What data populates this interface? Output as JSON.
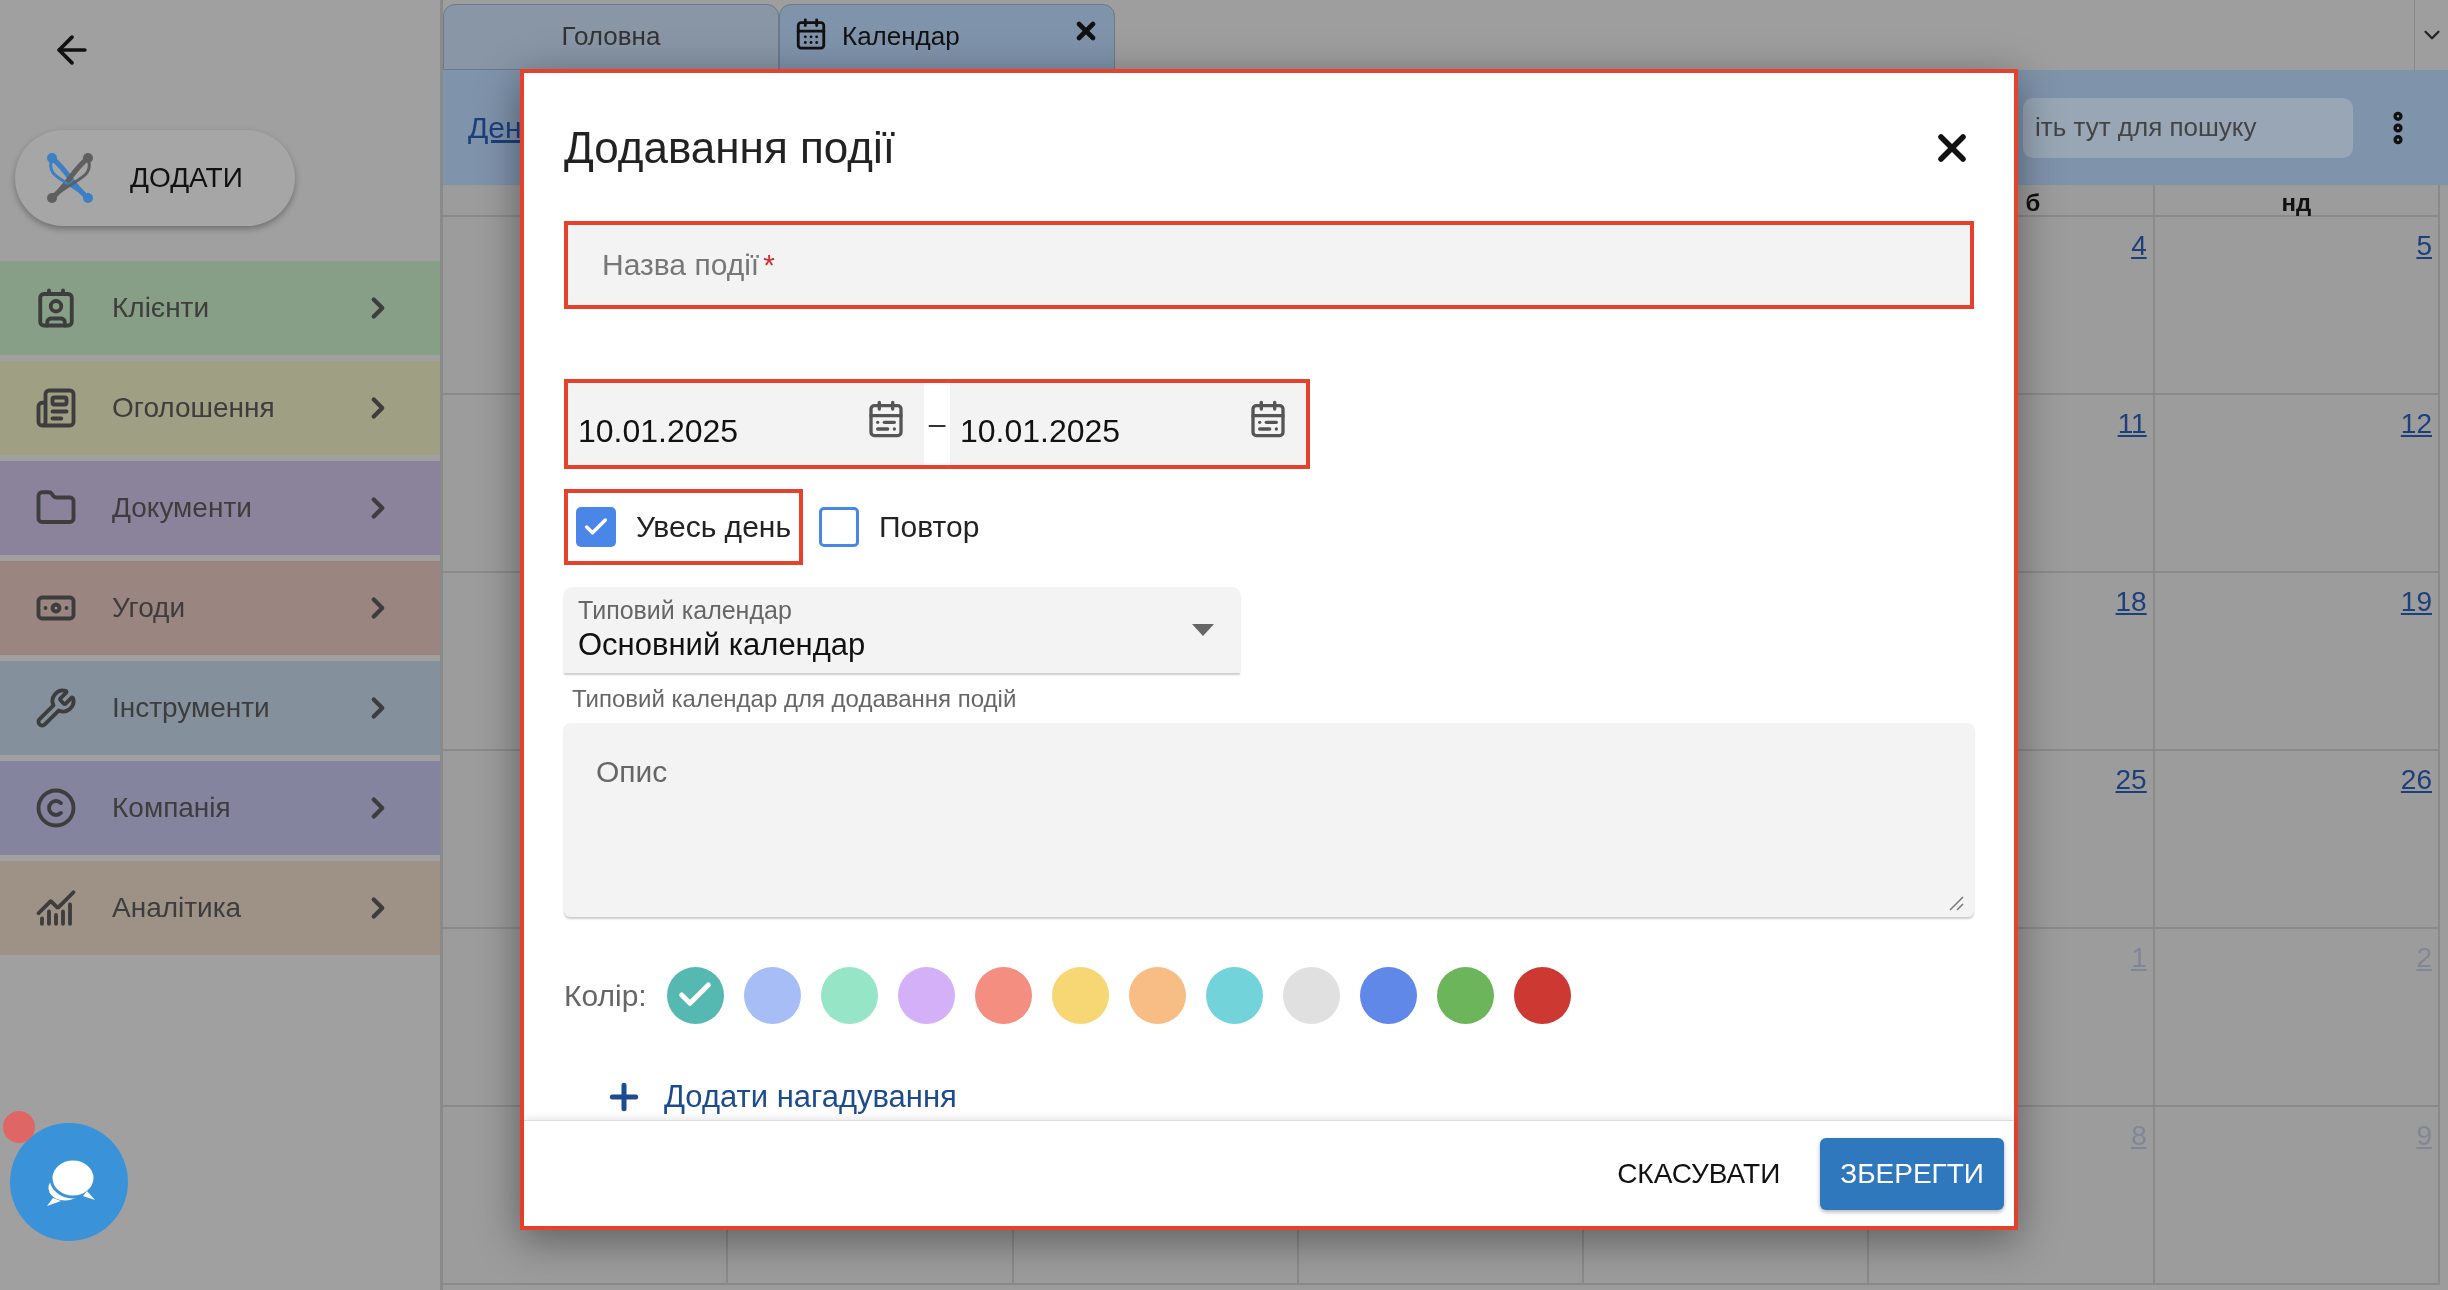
{
  "sidebar": {
    "add_button": "ДОДАТИ",
    "items": [
      {
        "label": "Клієнти",
        "color": "#879f86"
      },
      {
        "label": "Оголошення",
        "color": "#9e9f83"
      },
      {
        "label": "Документи",
        "color": "#8b839b"
      },
      {
        "label": "Угоди",
        "color": "#9a8581"
      },
      {
        "label": "Інструменти",
        "color": "#84919d"
      },
      {
        "label": "Компанія",
        "color": "#84849f"
      },
      {
        "label": "Аналітика",
        "color": "#9e9186"
      }
    ]
  },
  "tabs": [
    {
      "label": "Головна",
      "selected": false
    },
    {
      "label": "Календар",
      "selected": true
    }
  ],
  "toolbar": {
    "view_link": "Ден",
    "search_placeholder": "іть тут для пошуку"
  },
  "calendar": {
    "headers": [
      "б",
      "нд"
    ],
    "weeks": [
      [
        {
          "day": "4",
          "other_month": false
        },
        {
          "day": "5",
          "other_month": false
        }
      ],
      [
        {
          "day": "11",
          "other_month": false
        },
        {
          "day": "12",
          "other_month": false
        }
      ],
      [
        {
          "day": "18",
          "other_month": false
        },
        {
          "day": "19",
          "other_month": false
        }
      ],
      [
        {
          "day": "25",
          "other_month": false
        },
        {
          "day": "26",
          "other_month": false
        }
      ],
      [
        {
          "day": "1",
          "other_month": true
        },
        {
          "day": "2",
          "other_month": true
        }
      ],
      [
        {
          "day": "8",
          "other_month": true
        },
        {
          "day": "9",
          "other_month": true
        }
      ]
    ]
  },
  "dialog": {
    "title": "Додавання події",
    "highlighted": true,
    "name_field": {
      "placeholder": "Назва події",
      "required_mark": "*",
      "highlighted": true
    },
    "dates": {
      "from": "10.01.2025",
      "separator": "–",
      "to": "10.01.2025",
      "highlighted": true
    },
    "options": [
      {
        "label": "Увесь день",
        "checked": true,
        "highlighted": true
      },
      {
        "label": "Повтор",
        "checked": false,
        "highlighted": false
      }
    ],
    "calendar_select": {
      "label": "Типовий календар",
      "value": "Основний календар",
      "helper": "Типовий календар для додавання подій"
    },
    "description": {
      "placeholder": "Опис"
    },
    "color_label": "Колір:",
    "colors": [
      {
        "color": "#55b9b2",
        "selected": true
      },
      {
        "color": "#a7bdf6",
        "selected": false
      },
      {
        "color": "#96e5c6",
        "selected": false
      },
      {
        "color": "#d4b0f8",
        "selected": false
      },
      {
        "color": "#f38e80",
        "selected": false
      },
      {
        "color": "#f7d774",
        "selected": false
      },
      {
        "color": "#f7bd85",
        "selected": false
      },
      {
        "color": "#72d3da",
        "selected": false
      },
      {
        "color": "#e0e0e0",
        "selected": false
      },
      {
        "color": "#5f88e8",
        "selected": false
      },
      {
        "color": "#6db55a",
        "selected": false
      },
      {
        "color": "#cd3833",
        "selected": false
      }
    ],
    "add_reminder": "Додати нагадування",
    "buttons": [
      "СКАСУВАТИ",
      "ЗБЕРЕГТИ"
    ]
  }
}
